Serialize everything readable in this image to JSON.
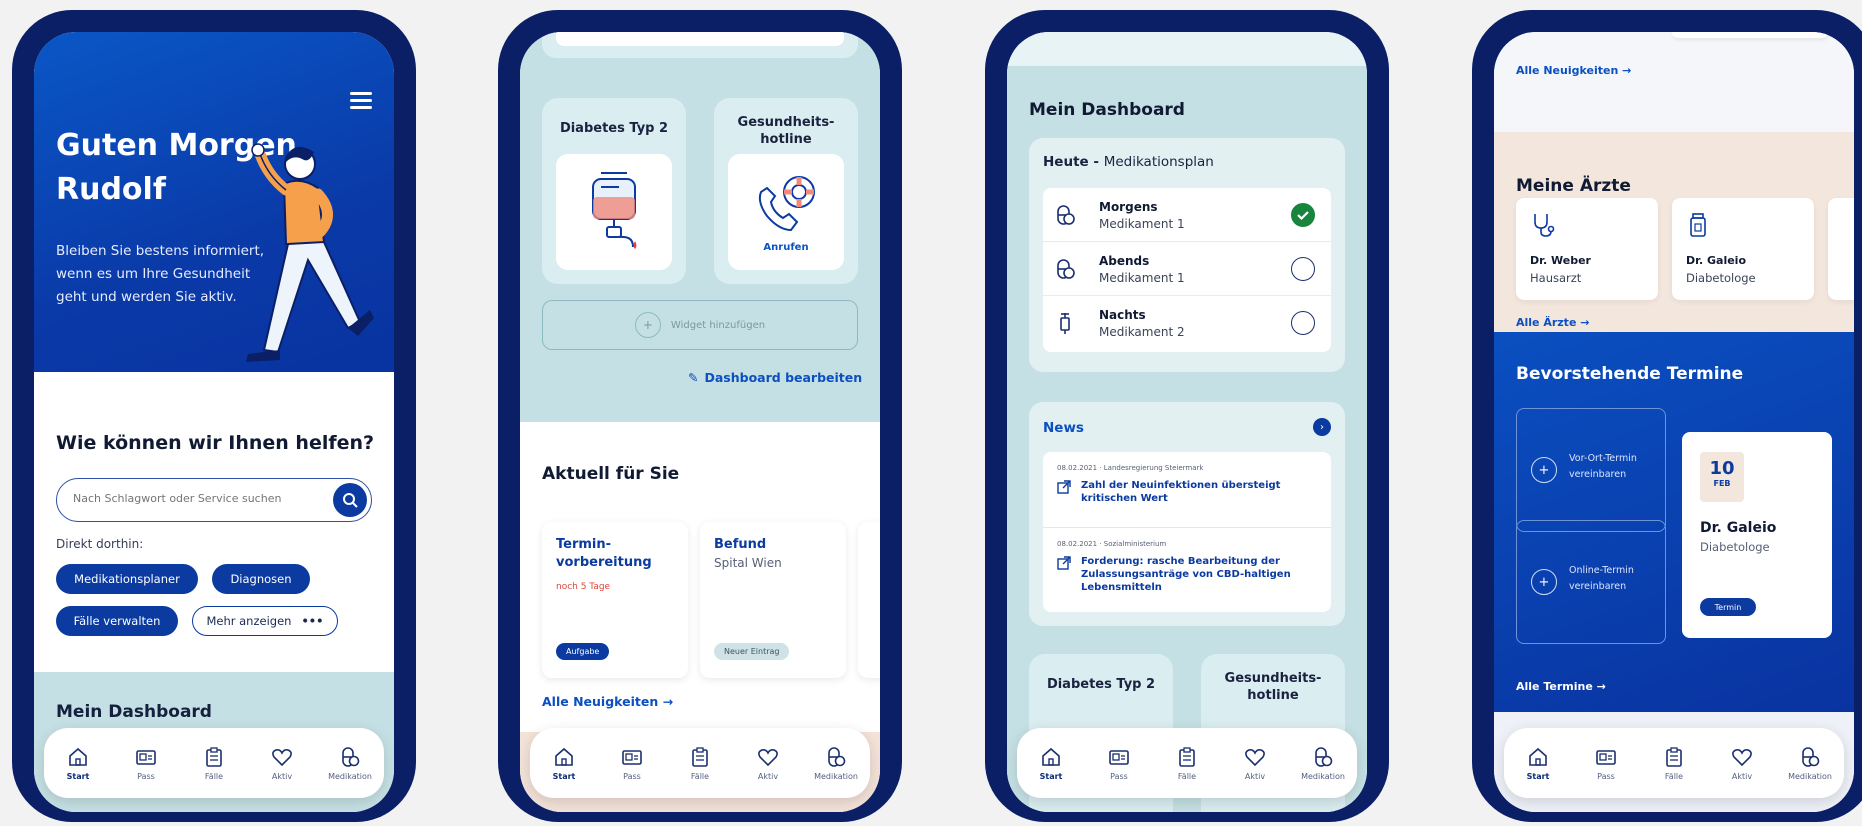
{
  "nav": [
    {
      "label": "Start",
      "icon": "home-icon"
    },
    {
      "label": "Pass",
      "icon": "id-card-icon"
    },
    {
      "label": "Fälle",
      "icon": "clipboard-icon"
    },
    {
      "label": "Aktiv",
      "icon": "heart-icon"
    },
    {
      "label": "Medikation",
      "icon": "pill-icon"
    }
  ],
  "phone1": {
    "greeting": "Guten Morgen Rudolf",
    "intro": "Bleiben Sie bestens informiert, wenn es um Ihre Gesundheit geht und werden Sie aktiv.",
    "help_title": "Wie können wir Ihnen helfen?",
    "search_placeholder": "Nach Schlagwort oder Service suchen",
    "direct_label": "Direkt dorthin:",
    "chips": [
      "Medikationsplaner",
      "Diagnosen",
      "Fälle verwalten",
      "Mehr anzeigen"
    ],
    "dashboard_title": "Mein Dashboard"
  },
  "phone2": {
    "widget1_title": "Diabetes Typ 2",
    "widget2_title": "Gesundheits-\nhotline",
    "widget2_link": "Anrufen",
    "add_widget": "Widget hinzufügen",
    "edit_dashboard": "Dashboard bearbeiten",
    "section_title": "Aktuell für Sie",
    "cards": [
      {
        "title": "Termin-\nvorbereitung",
        "sub": "noch 5 Tage",
        "badge": "Aufgabe"
      },
      {
        "title": "Befund",
        "sub": "Spital Wien",
        "badge": "Neuer Eintrag"
      }
    ],
    "all_news": "Alle Neuigkeiten →"
  },
  "phone3": {
    "dashboard_title": "Mein Dashboard",
    "today_bold": "Heute - ",
    "today_label": "Medikationsplan",
    "meds": [
      {
        "time": "Morgens",
        "name": "Medikament 1",
        "done": true
      },
      {
        "time": "Abends",
        "name": "Medikament 1",
        "done": false
      },
      {
        "time": "Nachts",
        "name": "Medikament 2",
        "done": false
      }
    ],
    "news_title": "News",
    "news": [
      {
        "meta": "08.02.2021 · Landesregierung Steiermark",
        "title": "Zahl der Neuinfektionen übersteigt kritischen Wert"
      },
      {
        "meta": "08.02.2021 · Sozialministerium",
        "title": "Forderung: rasche Bearbeitung der Zulassungsanträge von CBD-haltigen Lebensmitteln"
      }
    ],
    "widget1_title": "Diabetes Typ 2",
    "widget2_title": "Gesundheits-\nhotline"
  },
  "phone4": {
    "all_news": "Alle Neuigkeiten →",
    "doctors_title": "Meine Ärzte",
    "doctors": [
      {
        "name": "Dr. Weber",
        "role": "Hausarzt"
      },
      {
        "name": "Dr. Galeio",
        "role": "Diabetologe"
      }
    ],
    "all_doctors": "Alle Ärzte →",
    "appointments_title": "Bevorstehende Termine",
    "onsite": "Vor-Ort-Termin vereinbaren",
    "online": "Online-Termin vereinbaren",
    "appt_day": "10",
    "appt_month": "FEB",
    "appt_doctor": "Dr. Galeio",
    "appt_role": "Diabetologe",
    "appt_badge": "Termin",
    "all_appointments": "Alle Termine →"
  },
  "colors": {
    "primary": "#0b3aa0",
    "teal": "#c5e0e4",
    "success": "#17853e",
    "alert": "#e0453a"
  }
}
